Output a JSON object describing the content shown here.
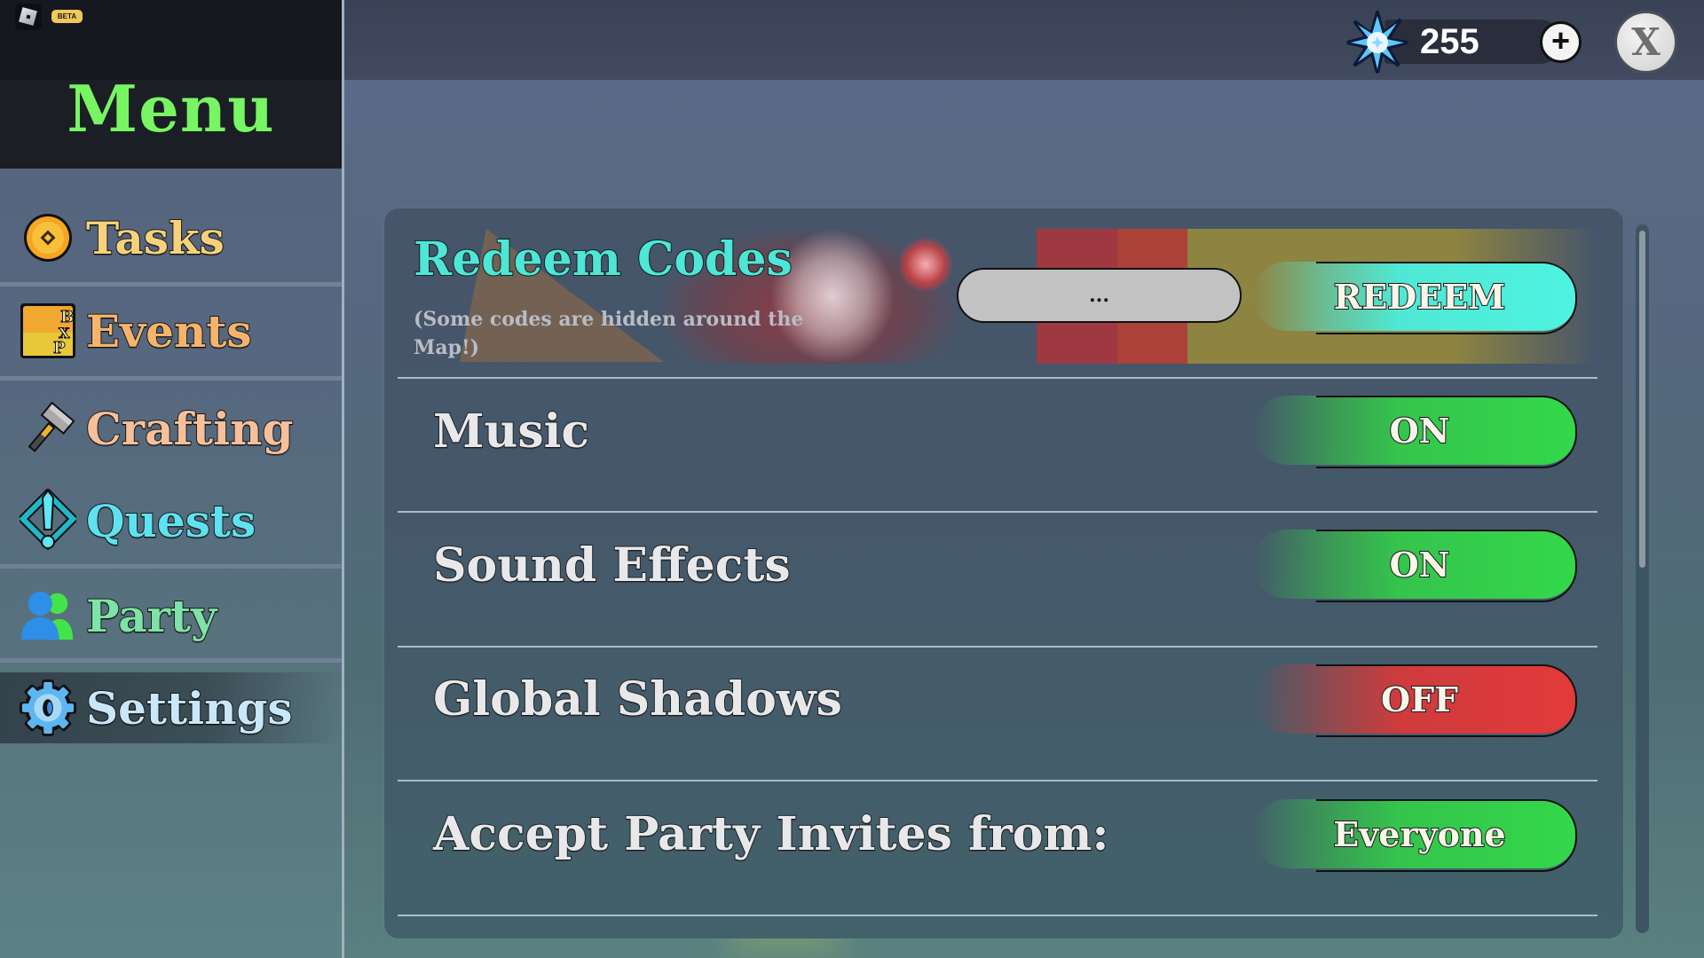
{
  "app": {
    "beta_badge": "BETA"
  },
  "sidebar": {
    "title": "Menu",
    "active_item": "Settings",
    "items": [
      {
        "label": "Tasks",
        "icon": "coin-icon",
        "color": "#f7d27a"
      },
      {
        "label": "Events",
        "icon": "event-pass-icon",
        "color": "#f5b46a"
      },
      {
        "label": "Crafting",
        "icon": "hammer-icon",
        "color": "#f7c09a"
      },
      {
        "label": "Quests",
        "icon": "quest-exclamation-icon",
        "color": "#5fe2f0"
      },
      {
        "label": "Party",
        "icon": "party-users-icon",
        "color": "#7ee3a6"
      },
      {
        "label": "Settings",
        "icon": "gear-icon",
        "color": "#c8e7fb"
      }
    ]
  },
  "header": {
    "currency_value": "255",
    "currency_icon": "lightning-star-icon",
    "add_currency_label": "+",
    "close_label": "X"
  },
  "settings": {
    "redeem": {
      "title": "Redeem Codes",
      "hint": "(Some codes are hidden around the Map!)",
      "input_placeholder": "...",
      "input_value": "",
      "button_label": "REDEEM",
      "button_color": "#4ef3e1"
    },
    "rows": [
      {
        "label": "Music",
        "value": "ON",
        "state": "on"
      },
      {
        "label": "Sound Effects",
        "value": "ON",
        "state": "on"
      },
      {
        "label": "Global Shadows",
        "value": "OFF",
        "state": "off"
      },
      {
        "label": "Accept Party Invites from:",
        "value": "Everyone",
        "state": "on"
      }
    ],
    "colors": {
      "on": "#33d84a",
      "off": "#e33a3a"
    }
  }
}
